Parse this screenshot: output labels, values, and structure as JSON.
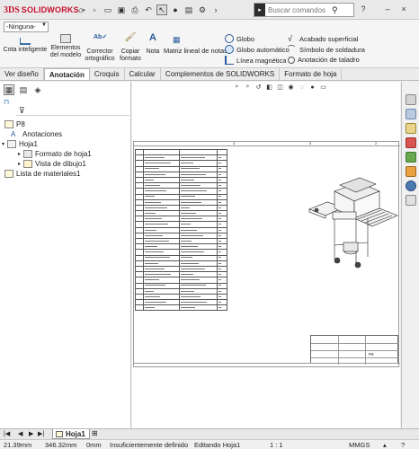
{
  "app": {
    "name": "SOLIDWORKS",
    "logo_prefix": "3DS",
    "brand_color": "#c8102e"
  },
  "titlebar": {
    "search_placeholder": "Buscar comandos",
    "icons": [
      "home-icon",
      "new-document-icon",
      "open-folder-icon",
      "save-icon",
      "print-icon",
      "undo-icon",
      "select-pointer-icon",
      "rebuild-icon",
      "options-gear-icon"
    ]
  },
  "ribbon": {
    "style_select": "-Ninguna-",
    "big_buttons": [
      {
        "id": "cota-inteligente",
        "label_line1": "Cota inteligente",
        "label_line2": ""
      },
      {
        "id": "elementos-modelo",
        "label_line1": "Elementos",
        "label_line2": "del modelo"
      },
      {
        "id": "corrector",
        "label_line1": "Corrector",
        "label_line2": "ortográfico"
      },
      {
        "id": "copiar-formato",
        "label_line1": "Copiar",
        "label_line2": "formato"
      },
      {
        "id": "nota",
        "label_line1": "Nota",
        "label_line2": ""
      }
    ],
    "matriz_label": "Matriz lineal de notas",
    "small_col1": [
      "Globo",
      "Globo automático",
      "Línea magnética"
    ],
    "small_col2": [
      "Acabado superficial",
      "Símbolo de soldadura",
      "Anotación de taladro"
    ]
  },
  "tabs": [
    {
      "label": "Ver diseño",
      "active": false
    },
    {
      "label": "Anotación",
      "active": true
    },
    {
      "label": "Croquis",
      "active": false
    },
    {
      "label": "Calcular",
      "active": false
    },
    {
      "label": "Complementos de SOLIDWORKS",
      "active": false
    },
    {
      "label": "Formato de hoja",
      "active": false
    }
  ],
  "tree": {
    "root": "P8",
    "anotaciones": "Anotaciones",
    "hoja": "Hoja1",
    "formato": "Formato de hoja1",
    "vista": "Vista de dibujo1",
    "lista": "Lista de materiales1"
  },
  "drawing": {
    "zone_numbers_top": [
      "4",
      "3",
      "2",
      "1"
    ],
    "zone_letters": [
      "D",
      "C",
      "B",
      "A"
    ],
    "title_block_sheet": "P8"
  },
  "sheet_tabs": {
    "active": "Hoja1"
  },
  "status": {
    "x": "21.39mm",
    "y": "346.32mm",
    "z": "0mm",
    "definition": "Insuficientemente definido",
    "editing": "Editando Hoja1",
    "scale": "1 : 1",
    "units": "MMGS"
  }
}
